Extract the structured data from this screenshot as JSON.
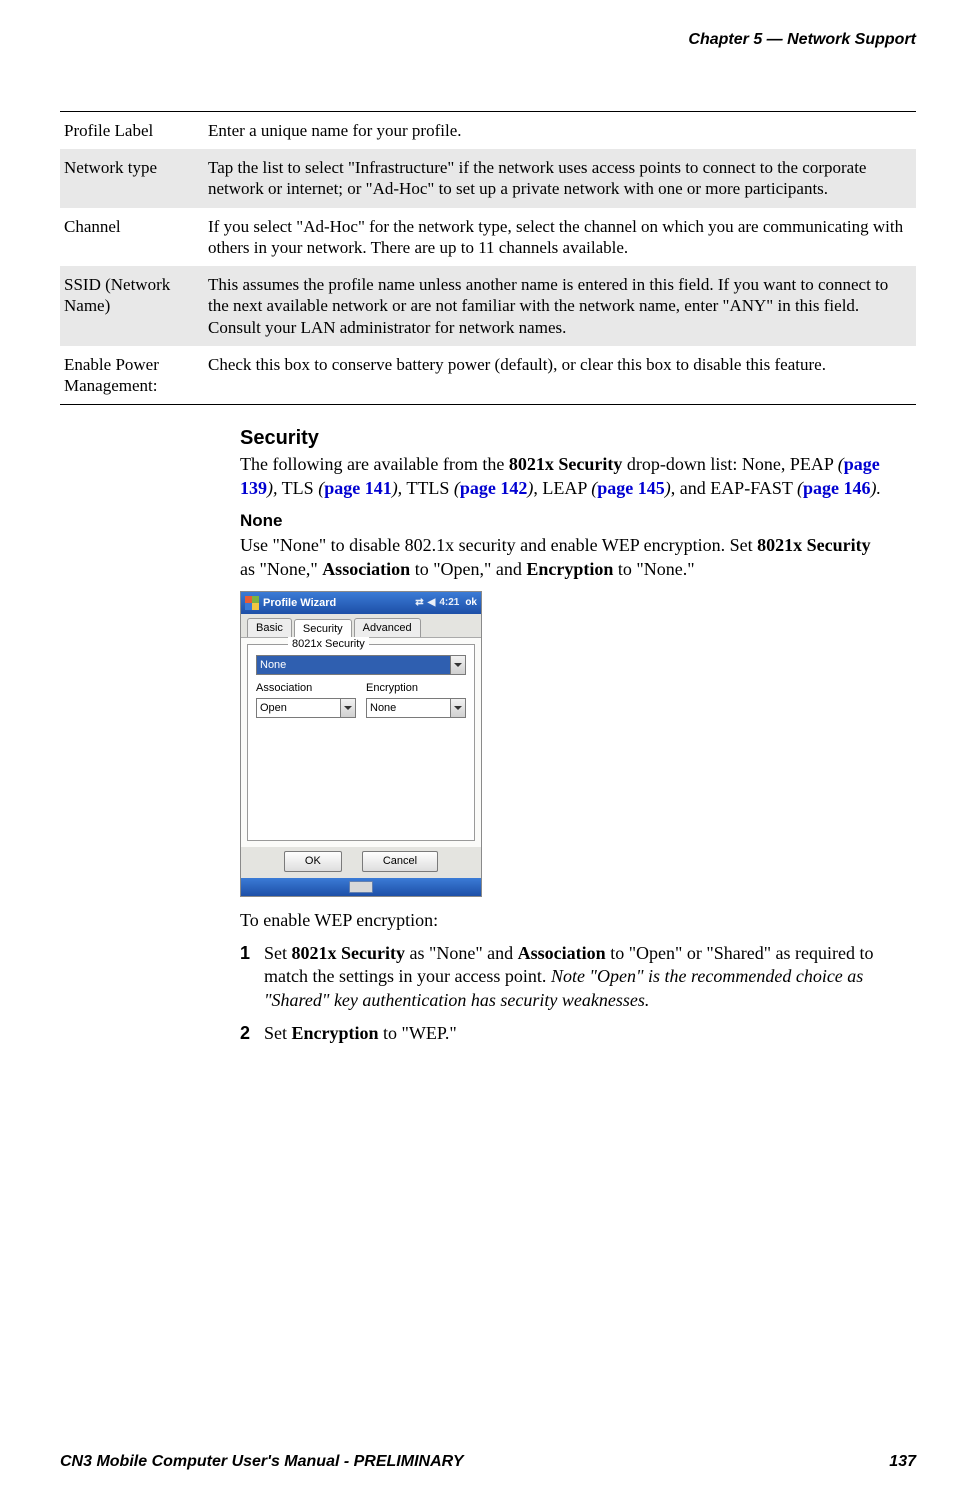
{
  "header": {
    "chapter": "Chapter 5 —  Network Support"
  },
  "table": {
    "rows": [
      {
        "label": "Profile Label",
        "desc": "Enter a unique name for your profile."
      },
      {
        "label": "Network type",
        "desc": "Tap the list to select \"Infrastructure\" if the network uses access points to connect to the corporate network or internet; or \"Ad-Hoc\" to set up a private network with one or more participants."
      },
      {
        "label": "Channel",
        "desc": "If you select \"Ad-Hoc\" for the network type, select the channel on which you are communicating with others in your network. There are up to 11 channels available."
      },
      {
        "label": "SSID (Network Name)",
        "desc": "This assumes the profile name unless another name is entered in this field. If you want to connect to the next available network or are not familiar with the network name, enter \"ANY\" in this field. Consult your LAN administrator for network names."
      },
      {
        "label": "Enable Power Management:",
        "desc": "Check this box to conserve battery power (default), or clear this box to disable this feature."
      }
    ]
  },
  "body": {
    "security_heading": "Security",
    "intro_a": "The following are available from the ",
    "intro_bold": "8021x Security",
    "intro_b": " drop-down list: None, PEAP ",
    "links": {
      "peap": "page 139",
      "tls": "page 141",
      "ttls": "page 142",
      "leap": "page 145",
      "eapfast": "page 146"
    },
    "none_heading": "None",
    "none_p1_a": "Use \"None\" to disable 802.1x security and enable WEP encryption. Set ",
    "none_p1_bold1": "8021x Security",
    "none_p1_b": " as \"None,\" ",
    "none_p1_bold2": "Association",
    "none_p1_c": " to \"Open,\" and ",
    "none_p1_bold3": "Encryption",
    "none_p1_d": " to \"None.\"",
    "wep_heading": "To enable WEP encryption:",
    "step1_a": "Set ",
    "step1_bold1": "8021x Security",
    "step1_b": " as \"None\" and ",
    "step1_bold2": "Association",
    "step1_c": " to \"Open\" or \"Shared\" as required to match the settings in your access point. ",
    "step1_italic": "Note \"Open\" is the recommended choice as \"Shared\" key authentication has security weaknesses.",
    "step2_a": "Set ",
    "step2_bold": "Encryption",
    "step2_b": " to \"WEP.\"",
    "num1": "1",
    "num2": "2"
  },
  "screenshot": {
    "title": "Profile Wizard",
    "time": "4:21",
    "ok": "ok",
    "tabs": {
      "basic": "Basic",
      "security": "Security",
      "advanced": "Advanced"
    },
    "group": "8021x Security",
    "combo_main": "None",
    "assoc_label": "Association",
    "assoc_value": "Open",
    "enc_label": "Encryption",
    "enc_value": "None",
    "btn_ok": "OK",
    "btn_cancel": "Cancel"
  },
  "footer": {
    "left": "CN3 Mobile Computer User's Manual - PRELIMINARY",
    "right": "137"
  }
}
